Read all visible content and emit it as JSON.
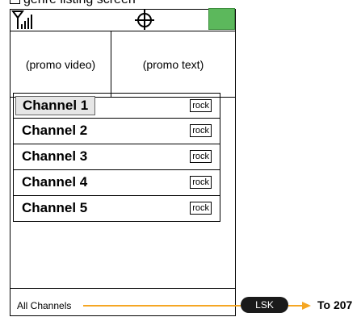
{
  "screen": {
    "caption": "genre listing screen"
  },
  "status_bar": {
    "signal_icon": "signal-strength-icon",
    "center_icon": "crosshair-target-icon",
    "battery_icon": "battery-icon",
    "battery_color": "#5cb85c"
  },
  "promo": {
    "video_label": "(promo video)",
    "text_label": "(promo text)"
  },
  "channels": [
    {
      "name": "Channel 1",
      "genre": "rock",
      "selected": true
    },
    {
      "name": "Channel 2",
      "genre": "rock",
      "selected": false
    },
    {
      "name": "Channel 3",
      "genre": "rock",
      "selected": false
    },
    {
      "name": "Channel 4",
      "genre": "rock",
      "selected": false
    },
    {
      "name": "Channel 5",
      "genre": "rock",
      "selected": false
    }
  ],
  "softkeys": {
    "left_label": "All Channels"
  },
  "annotation": {
    "key_label": "LSK",
    "target_label": "To 207",
    "arrow_color": "#f5a623"
  }
}
